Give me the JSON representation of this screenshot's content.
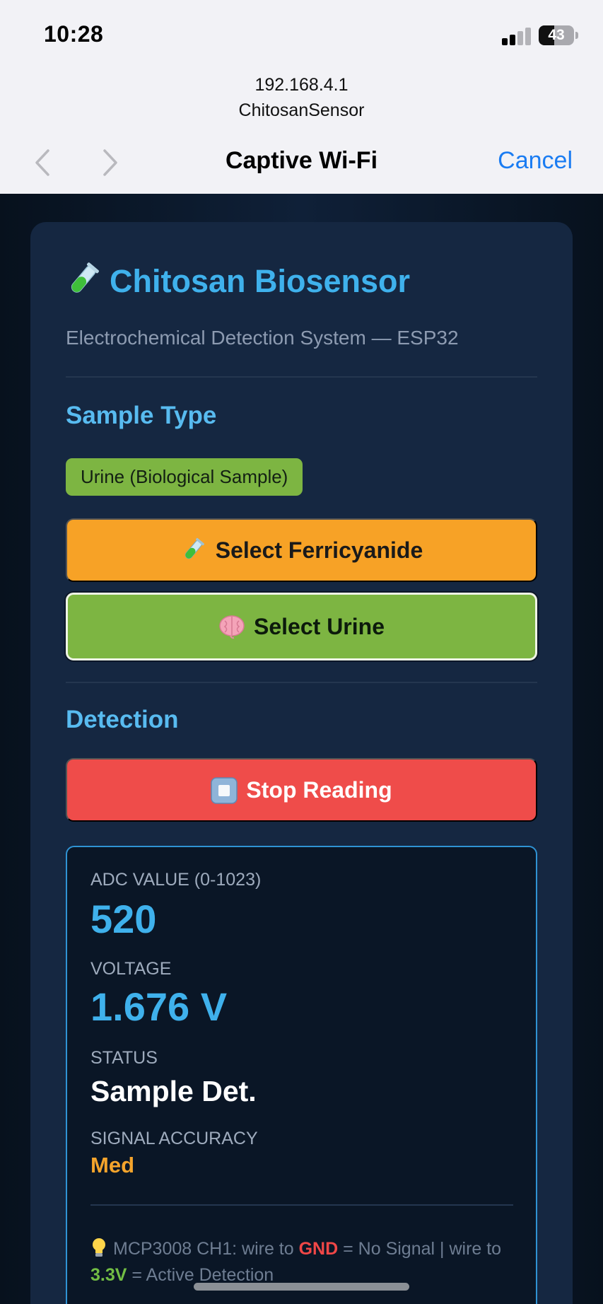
{
  "status_bar": {
    "time": "10:28",
    "battery": "43",
    "battery_level": 0.43
  },
  "browser": {
    "host": "192.168.4.1",
    "ssid": "ChitosanSensor",
    "title": "Captive Wi-Fi",
    "cancel_label": "Cancel",
    "back_icon": "chevron-left-icon",
    "forward_icon": "chevron-right-icon"
  },
  "app": {
    "title": "Chitosan Biosensor",
    "title_icon": "test-tube-icon",
    "subtitle": "Electrochemical Detection System — ESP32"
  },
  "sample": {
    "section_title": "Sample Type",
    "selected_chip": "Urine (Biological Sample)",
    "ferricyanide_label": "Select Ferricyanide",
    "ferricyanide_icon": "test-tube-icon",
    "urine_label": "Select Urine",
    "urine_icon": "brain-icon"
  },
  "detection": {
    "section_title": "Detection",
    "stop_label": "Stop Reading",
    "stop_icon": "stop-square-icon"
  },
  "readings": {
    "adc_label": "ADC VALUE (0-1023)",
    "adc_value": "520",
    "voltage_label": "VOLTAGE",
    "voltage_value": "1.676 V",
    "status_label": "STATUS",
    "status_value": "Sample Det.",
    "accuracy_label": "SIGNAL ACCURACY",
    "accuracy_value": "Med"
  },
  "hint": {
    "icon": "lightbulb-icon",
    "prefix": "MCP3008 CH1: wire to",
    "gnd": "GND",
    "gnd_result": "= No Signal  |  wire to",
    "v33": "3.3V",
    "v33_result": "= Active Detection"
  },
  "colors": {
    "accent_blue": "#3fb1ec",
    "ferricyanide_orange": "#f7a226",
    "urine_green": "#7db542",
    "stop_red": "#ef4c4a",
    "ios_link_blue": "#1a7cf2"
  }
}
